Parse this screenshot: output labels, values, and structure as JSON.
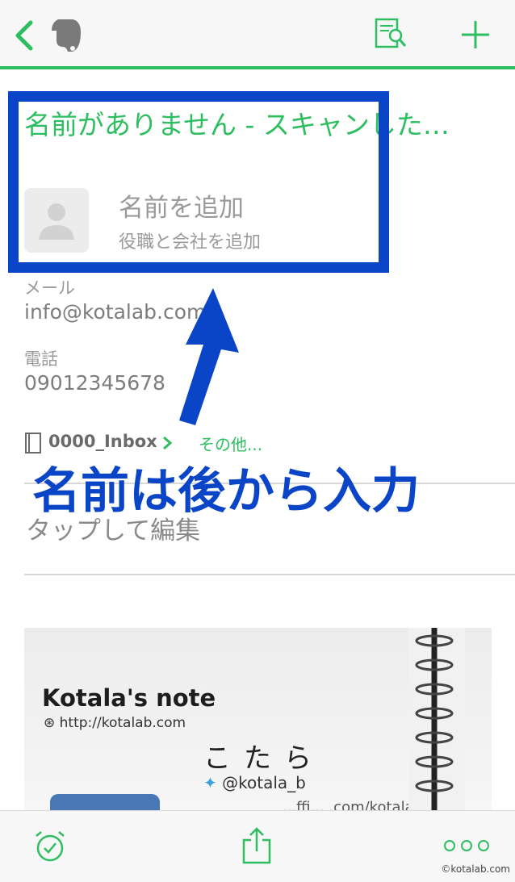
{
  "colors": {
    "accent": "#2dbe60",
    "annotation": "#0a45c8"
  },
  "topbar": {
    "back_icon": "chevron-left-icon",
    "logo_icon": "evernote-elephant-icon",
    "scan_icon": "document-search-icon",
    "add_icon": "plus-icon"
  },
  "note": {
    "title": "名前がありません - スキャンした…",
    "contact": {
      "name_placeholder": "名前を追加",
      "role_placeholder": "役職と会社を追加",
      "email_label": "メール",
      "email_value": "info@kotalab.com",
      "phone_label": "電話",
      "phone_value": "09012345678"
    },
    "notebook": {
      "name": "0000_Inbox",
      "more_label": "その他..."
    },
    "tap_to_edit": "タップして編集"
  },
  "annotation": {
    "text": "名前は後から入力"
  },
  "business_card": {
    "title": "Kotala's note",
    "url": "http://kotalab.com",
    "name": "こたら",
    "twitter": "@kotala_b",
    "cut_text": "...ffi... .com/kotalab"
  },
  "bottombar": {
    "reminder_icon": "alarm-clock-icon",
    "share_icon": "share-icon",
    "more_icon": "more-dots-icon"
  },
  "watermark": "©kotalab.com"
}
